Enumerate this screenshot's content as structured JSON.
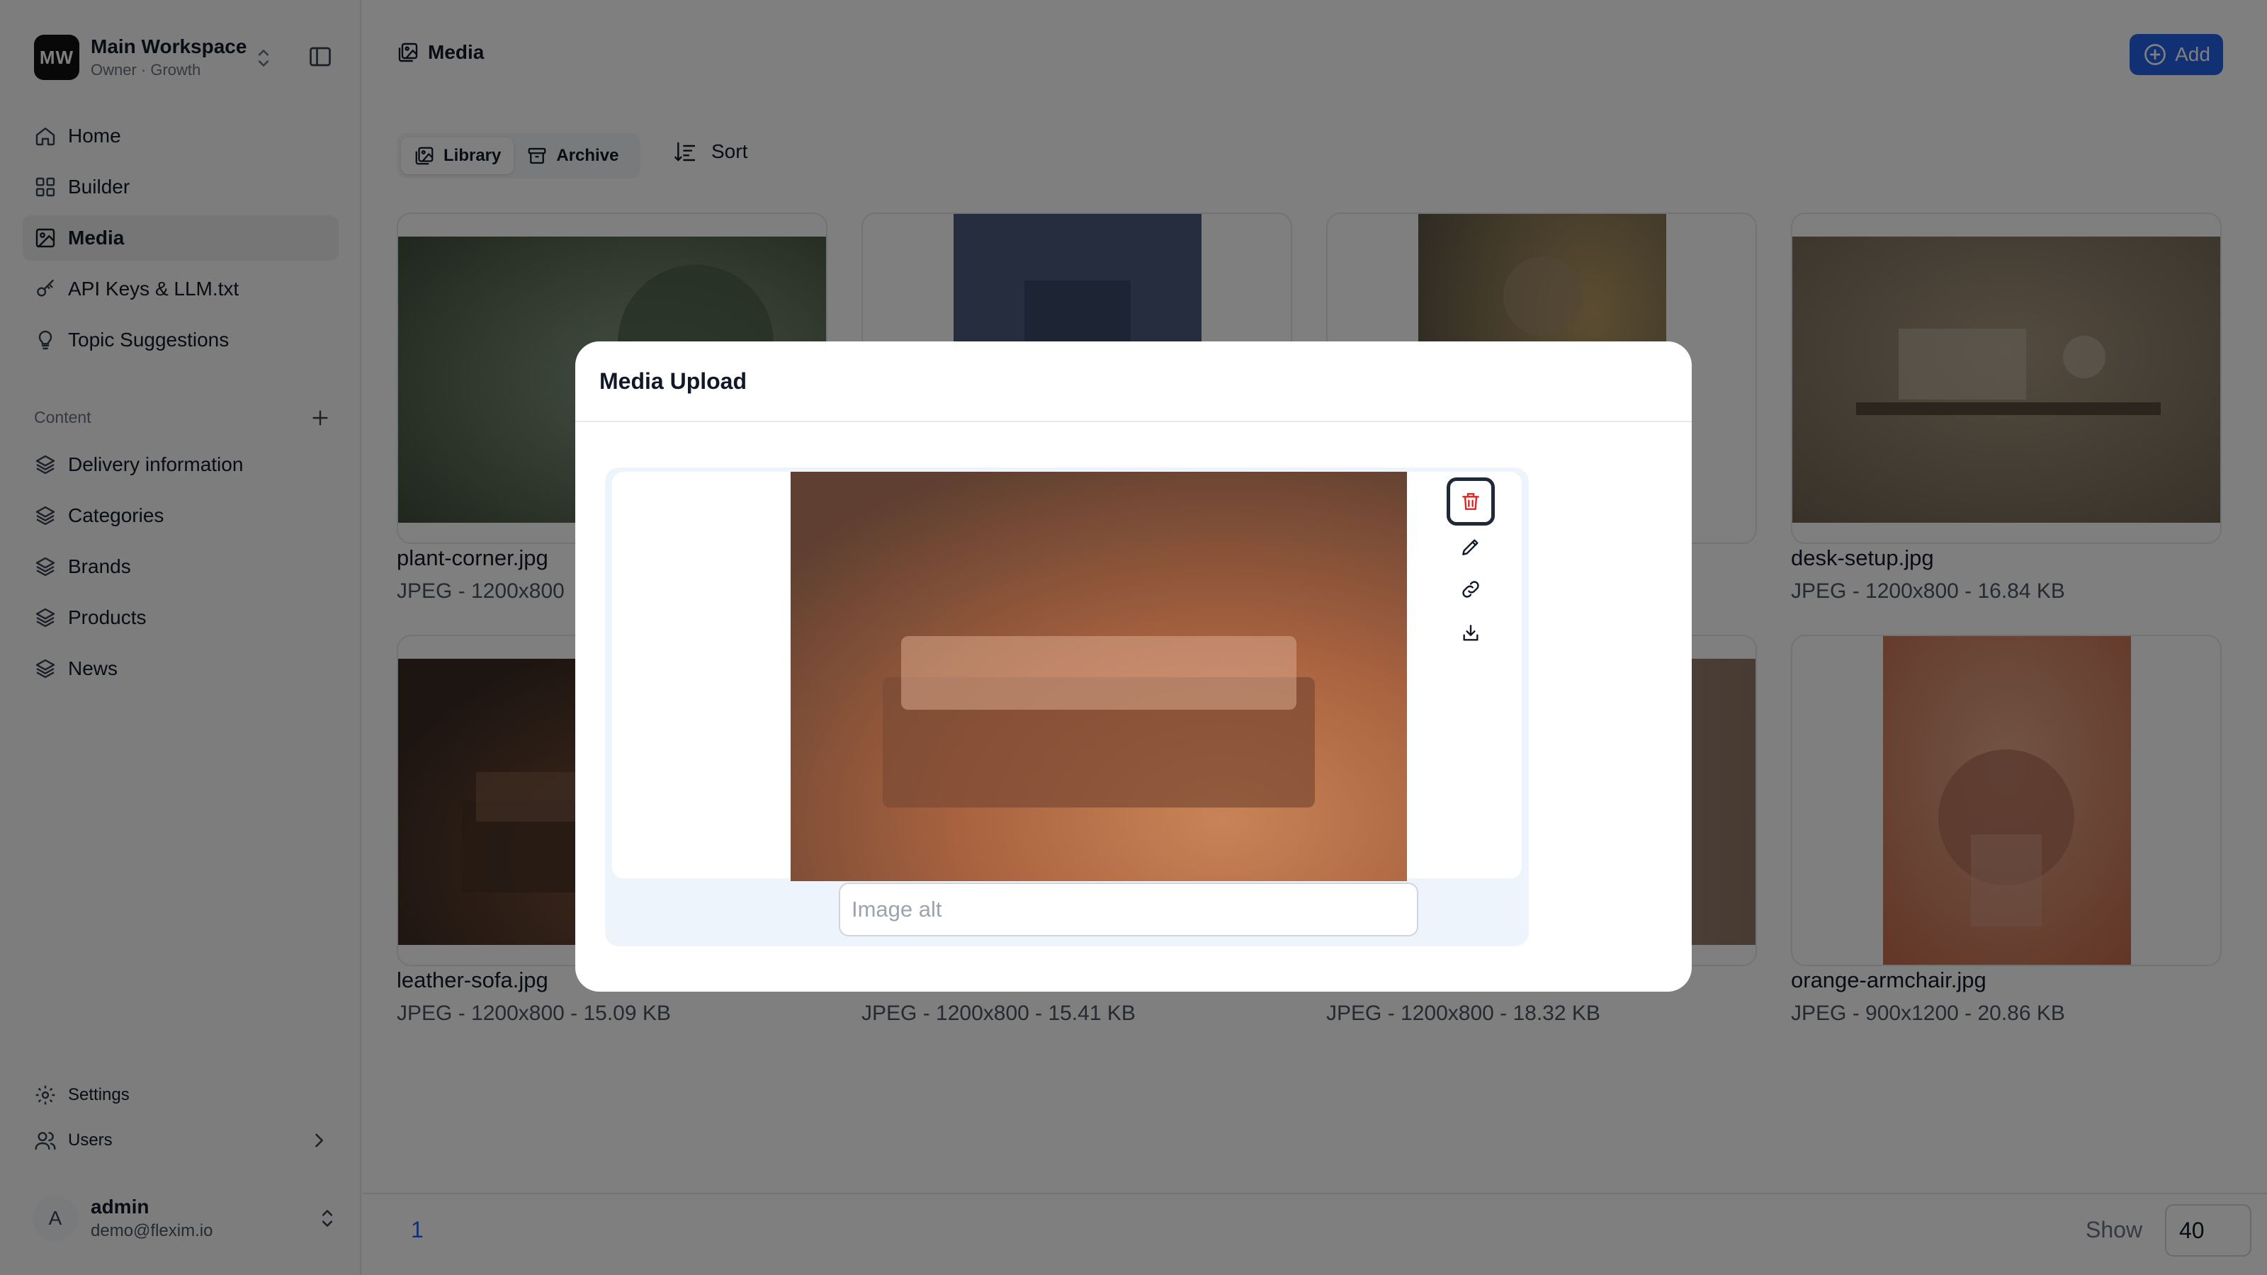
{
  "workspace": {
    "initials": "MW",
    "name": "Main Workspace",
    "subtitle": "Owner · Growth"
  },
  "sidebar": {
    "nav": [
      {
        "label": "Home",
        "icon": "home-icon"
      },
      {
        "label": "Builder",
        "icon": "grid-icon"
      },
      {
        "label": "Media",
        "icon": "image-icon",
        "active": true
      },
      {
        "label": "API Keys & LLM.txt",
        "icon": "key-icon"
      },
      {
        "label": "Topic Suggestions",
        "icon": "lightbulb-icon"
      }
    ],
    "content_section": "Content",
    "content_items": [
      {
        "label": "Delivery information",
        "icon": "layers-icon"
      },
      {
        "label": "Categories",
        "icon": "layers-icon"
      },
      {
        "label": "Brands",
        "icon": "layers-icon"
      },
      {
        "label": "Products",
        "icon": "layers-icon"
      },
      {
        "label": "News",
        "icon": "layers-icon"
      }
    ],
    "settings_label": "Settings",
    "users_label": "Users"
  },
  "user": {
    "initial": "A",
    "name": "admin",
    "email": "demo@flexim.io"
  },
  "header": {
    "title": "Media",
    "add_label": "Add"
  },
  "toolbar": {
    "library_label": "Library",
    "archive_label": "Archive",
    "sort_label": "Sort"
  },
  "media": [
    {
      "name": "plant-corner.jpg",
      "meta": "JPEG - 1200x800"
    },
    {
      "name": "",
      "meta": ""
    },
    {
      "name": "",
      "meta": ""
    },
    {
      "name": "desk-setup.jpg",
      "meta": "JPEG - 1200x800 - 16.84 KB"
    },
    {
      "name": "leather-sofa.jpg",
      "meta": "JPEG - 1200x800 - 15.09 KB"
    },
    {
      "name": "",
      "meta": "JPEG - 1200x800 - 15.41 KB"
    },
    {
      "name": "",
      "meta": "JPEG - 1200x800 - 18.32 KB"
    },
    {
      "name": "orange-armchair.jpg",
      "meta": "JPEG - 900x1200 - 20.86 KB"
    }
  ],
  "pagination": {
    "page": "1",
    "show_label": "Show",
    "show_value": "40"
  },
  "modal": {
    "title": "Media Upload",
    "alt_placeholder": "Image alt"
  },
  "colors": {
    "accent": "#2563eb",
    "danger": "#dc2626"
  }
}
